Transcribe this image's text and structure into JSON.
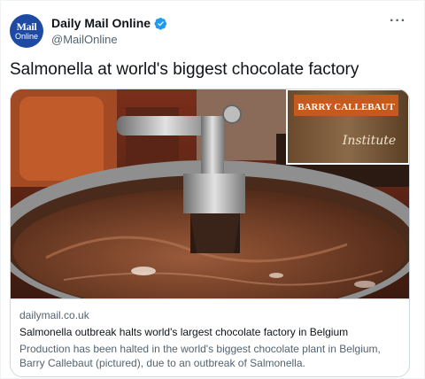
{
  "account": {
    "display_name": "Daily Mail Online",
    "handle": "@MailOnline",
    "avatar_line1": "Mail",
    "avatar_line2": "Online",
    "verified_icon": "verified-badge-icon",
    "more_label": "···"
  },
  "tweet": {
    "text": "Salmonella at world's biggest chocolate factory"
  },
  "card": {
    "domain": "dailymail.co.uk",
    "title": "Salmonella outbreak halts world's largest chocolate factory in Belgium",
    "description": "Production has been halted in the world's biggest chocolate plant in Belgium, Barry Callebaut (pictured), due to an outbreak of Salmonella.",
    "image_sign_brand": "BARRY CALLEBAUT",
    "image_sign_sub": "Institute"
  },
  "colors": {
    "verified_blue": "#1d9bf0",
    "avatar_blue": "#1f4aa3",
    "chocolate": "#6b3a23"
  }
}
